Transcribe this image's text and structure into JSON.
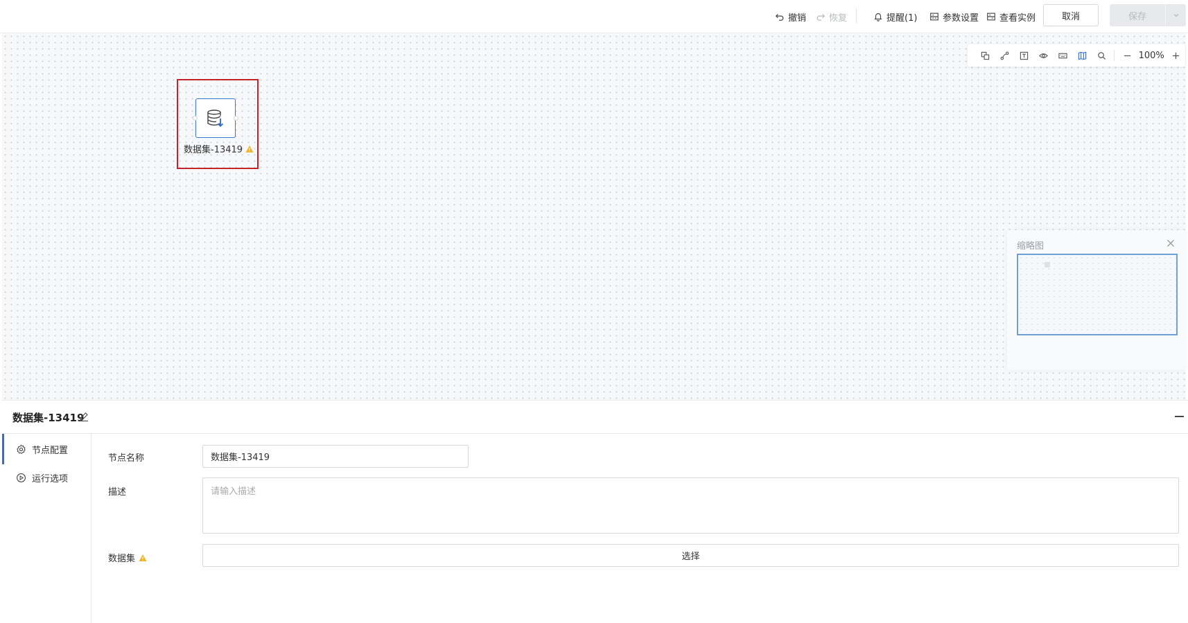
{
  "header": {
    "undo_label": "撤销",
    "redo_label": "恢复",
    "reminder_label": "提醒(1)",
    "params_label": "参数设置",
    "instances_label": "查看实例",
    "cancel_label": "取消",
    "save_label": "保存"
  },
  "toolbar": {
    "icons": [
      "copy-icon",
      "link-icon",
      "text-icon",
      "eye-icon",
      "keyboard-icon",
      "map-icon",
      "search-icon"
    ],
    "zoom_value": "100%"
  },
  "node": {
    "label": "数据集-13419",
    "icon": "database-import-icon",
    "status_icon": "warning-icon"
  },
  "minimap": {
    "title": "缩略图"
  },
  "panel": {
    "title": "数据集-13419",
    "nav": [
      {
        "label": "节点配置",
        "icon": "gear-icon",
        "active": true
      },
      {
        "label": "运行选项",
        "icon": "play-circle-icon",
        "active": false
      }
    ],
    "form": {
      "name_label": "节点名称",
      "name_value": "数据集-13419",
      "desc_label": "描述",
      "desc_placeholder": "请输入描述",
      "dataset_label": "数据集",
      "select_label": "选择"
    }
  },
  "colors": {
    "accent": "#2f6fd0",
    "selection": "#c4242c",
    "warning": "#f0b429"
  }
}
